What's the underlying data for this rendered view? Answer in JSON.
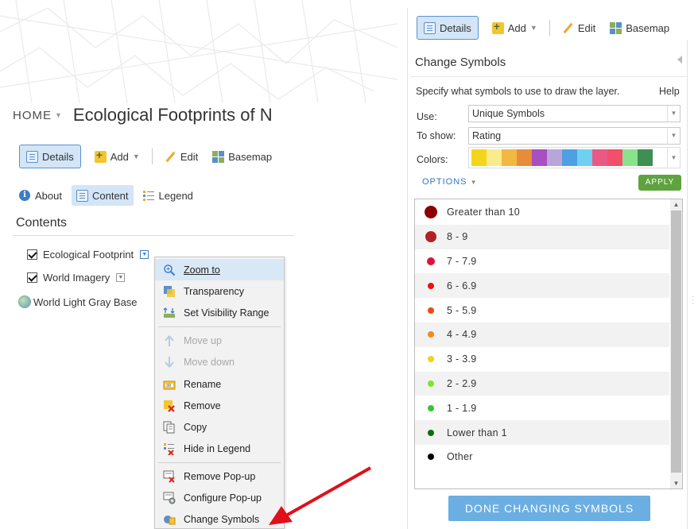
{
  "left_panel": {
    "home_label": "HOME",
    "map_title": "Ecological Footprints of N",
    "toolbar": {
      "details": "Details",
      "add": "Add",
      "edit": "Edit",
      "basemap": "Basemap"
    },
    "tabs": {
      "about": "About",
      "content": "Content",
      "legend": "Legend"
    },
    "contents_heading": "Contents",
    "layers": [
      {
        "label": "Ecological Footprint",
        "checked": true
      },
      {
        "label": "World Imagery",
        "checked": true
      },
      {
        "label": "World Light Gray Base"
      }
    ]
  },
  "context_menu": {
    "items": [
      {
        "label": "Zoom to",
        "icon": "zoom-icon",
        "highlighted": true
      },
      {
        "label": "Transparency",
        "icon": "transparency-icon"
      },
      {
        "label": "Set Visibility Range",
        "icon": "visibility-range-icon"
      },
      {
        "label": "Move up",
        "icon": "arrow-up-icon",
        "disabled": true
      },
      {
        "label": "Move down",
        "icon": "arrow-down-icon",
        "disabled": true
      },
      {
        "label": "Rename",
        "icon": "rename-icon"
      },
      {
        "label": "Remove",
        "icon": "remove-icon"
      },
      {
        "label": "Copy",
        "icon": "copy-icon"
      },
      {
        "label": "Hide in Legend",
        "icon": "hide-legend-icon"
      },
      {
        "label": "Remove Pop-up",
        "icon": "remove-popup-icon"
      },
      {
        "label": "Configure Pop-up",
        "icon": "configure-popup-icon"
      },
      {
        "label": "Change Symbols",
        "icon": "change-symbols-icon"
      }
    ]
  },
  "right_panel": {
    "toolbar": {
      "details": "Details",
      "add": "Add",
      "edit": "Edit",
      "basemap": "Basemap"
    },
    "title": "Change Symbols",
    "description": "Specify what symbols to use to draw the layer.",
    "help": "Help",
    "use_label": "Use:",
    "use_value": "Unique Symbols",
    "to_show_label": "To show:",
    "to_show_value": "Rating",
    "colors_label": "Colors:",
    "color_ramp": [
      "#f5d51b",
      "#faeb8c",
      "#f2b843",
      "#e88c3a",
      "#a94fc1",
      "#b8a6d9",
      "#4f9fe3",
      "#6fd0f0",
      "#e85a84",
      "#f24f6a",
      "#8ae28c",
      "#3f8f53"
    ],
    "options_label": "OPTIONS",
    "apply_label": "APPLY",
    "symbols": [
      {
        "label": "Greater than 10",
        "color": "#8b0000",
        "size": 16
      },
      {
        "label": "8 - 9",
        "color": "#b22222",
        "size": 14
      },
      {
        "label": "7 - 7.9",
        "color": "#dc143c",
        "size": 10
      },
      {
        "label": "6 - 6.9",
        "color": "#ee1111",
        "size": 8
      },
      {
        "label": "5 - 5.9",
        "color": "#f04a14",
        "size": 8
      },
      {
        "label": "4 - 4.9",
        "color": "#f28a1c",
        "size": 8
      },
      {
        "label": "3 - 3.9",
        "color": "#f2d21c",
        "size": 8
      },
      {
        "label": "2 - 2.9",
        "color": "#7ee62a",
        "size": 8
      },
      {
        "label": "1 - 1.9",
        "color": "#35c435",
        "size": 8
      },
      {
        "label": "Lower than 1",
        "color": "#0f6b0f",
        "size": 8
      },
      {
        "label": "Other",
        "color": "#000000",
        "size": 8
      }
    ],
    "done_label": "DONE CHANGING SYMBOLS"
  },
  "colors": {
    "accent_blue": "#2f78c4",
    "active_bg": "#d3e5f7",
    "apply_green": "#5ea33f",
    "done_blue": "#6baee2",
    "annotation_arrow": "#e0101a"
  }
}
